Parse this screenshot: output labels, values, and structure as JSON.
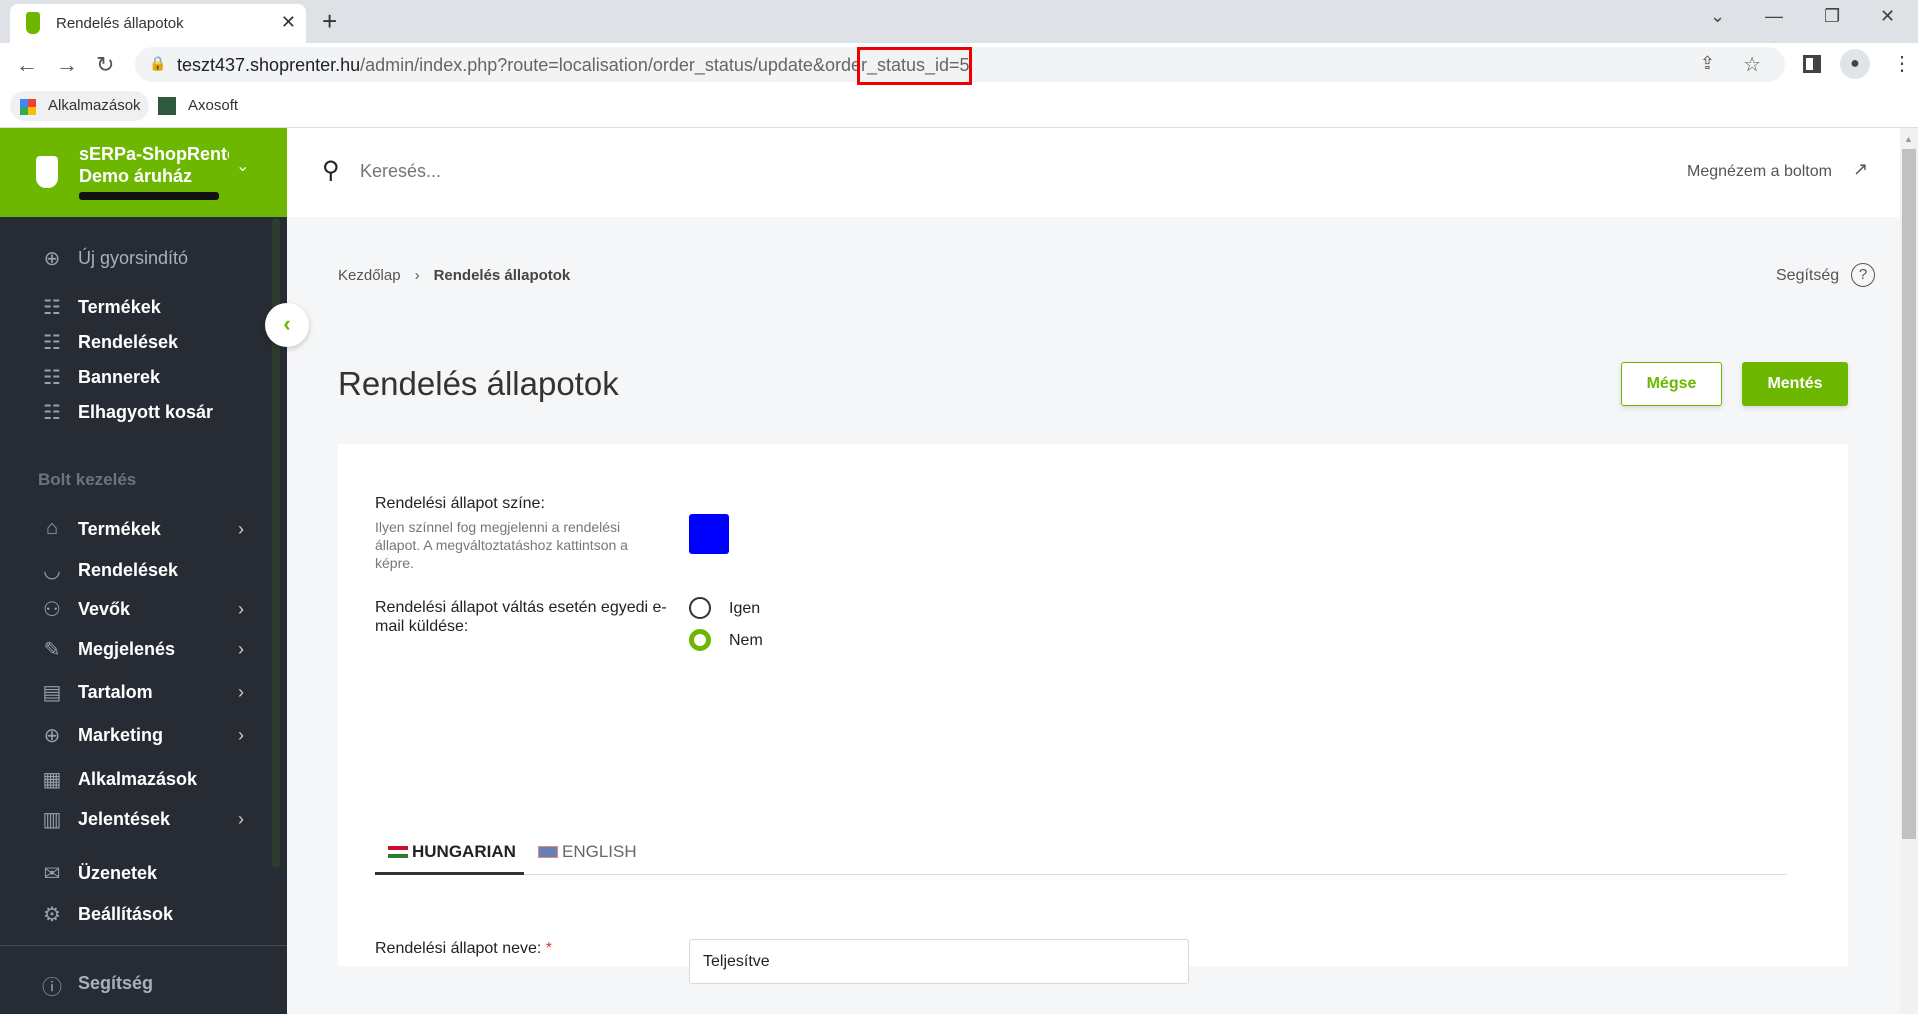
{
  "browser": {
    "tab_title": "Rendelés állapotok",
    "url_host": "teszt437.shoprenter.hu",
    "url_path": "/admin/index.php?route=localisation/order_status/update&order_status_id=5",
    "bookmarks": [
      {
        "label": "Alkalmazások",
        "icon": "apps-grid-icon"
      },
      {
        "label": "Axosoft",
        "icon": "axosoft-icon"
      }
    ]
  },
  "sidebar": {
    "shop_name_line1": "sERPa-ShopRenter",
    "shop_name_line2": "Demo áruház",
    "quick": {
      "label": "Új gyorsindító"
    },
    "shortcuts": [
      {
        "label": "Termékek"
      },
      {
        "label": "Rendelések"
      },
      {
        "label": "Bannerek"
      },
      {
        "label": "Elhagyott kosár"
      }
    ],
    "section_title": "Bolt kezelés",
    "items": [
      {
        "label": "Termékek",
        "icon": "tag-icon",
        "chevron": true
      },
      {
        "label": "Rendelések",
        "icon": "basket-icon",
        "chevron": false
      },
      {
        "label": "Vevők",
        "icon": "users-icon",
        "chevron": true
      },
      {
        "label": "Megjelenés",
        "icon": "brush-icon",
        "chevron": true
      },
      {
        "label": "Tartalom",
        "icon": "note-icon",
        "chevron": true
      },
      {
        "label": "Marketing",
        "icon": "target-icon",
        "chevron": true
      },
      {
        "label": "Alkalmazások",
        "icon": "apps-icon",
        "chevron": false
      },
      {
        "label": "Jelentések",
        "icon": "chart-icon",
        "chevron": true
      }
    ],
    "bottom": [
      {
        "label": "Üzenetek",
        "icon": "mail-icon"
      },
      {
        "label": "Beállítások",
        "icon": "settings-icon"
      }
    ],
    "help": "Segítség"
  },
  "header": {
    "search_placeholder": "Keresés...",
    "view_shop": "Megnézem a boltom"
  },
  "breadcrumb": {
    "home": "Kezdőlap",
    "current": "Rendelés állapotok"
  },
  "help_link": "Segítség",
  "page_title": "Rendelés állapotok",
  "actions": {
    "cancel": "Mégse",
    "save": "Mentés"
  },
  "form": {
    "color_label": "Rendelési állapot színe:",
    "color_hint": "Ilyen színnel fog megjelenni a rendelési állapot. A megváltoztatáshoz kattintson a képre.",
    "color_value": "#0000ff",
    "email_label": "Rendelési állapot váltás esetén egyedi e-mail küldése:",
    "email_options": [
      {
        "label": "Igen",
        "checked": false
      },
      {
        "label": "Nem",
        "checked": true
      }
    ],
    "lang_tabs": [
      {
        "label": "HUNGARIAN",
        "active": true
      },
      {
        "label": "ENGLISH",
        "active": false
      }
    ],
    "name_label": "Rendelési állapot neve:",
    "required_mark": "*",
    "name_value": "Teljesítve"
  },
  "colors": {
    "accent": "#6db700",
    "sidebar": "#272b33"
  }
}
